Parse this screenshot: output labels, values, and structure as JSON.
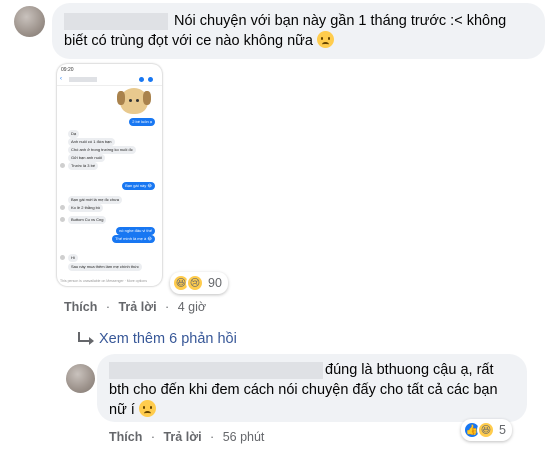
{
  "comment1": {
    "text_line1": "Nói chuyện với bạn này gần 1 tháng trước :< không",
    "text_line2": "biết có trùng đọt với ce nào không nữa",
    "emoji": "sad-face-icon",
    "reactions_count": "90",
    "like_label": "Thích",
    "reply_label": "Trả lời",
    "time": "4 giờ"
  },
  "screenshot": {
    "status_time": "09:20",
    "messages": [
      {
        "side": "out",
        "text": "2 bé luôn ạ"
      },
      {
        "side": "in",
        "text": "Dạ"
      },
      {
        "side": "in",
        "text": "Anh nuôi có 1 đứa bạn"
      },
      {
        "side": "in",
        "text": "Chó anh ở trong trường ko nuôi đc"
      },
      {
        "side": "in",
        "text": "Gửi bạn anh nuôi"
      },
      {
        "side": "in",
        "text": "Trước là 3 bé"
      },
      {
        "side": "out",
        "text": "Bạn gái này 😂"
      },
      {
        "side": "in",
        "text": "Bạn gái mới là mẹ đc chưa"
      },
      {
        "side": "in",
        "text": "Ko lề 2 thằng bồ"
      },
      {
        "side": "in",
        "text": "Buttom Cu vs Cng"
      },
      {
        "side": "out",
        "text": "nó nghe đâu vl thế"
      },
      {
        "side": "out",
        "text": "Thế mình là mẹ à 😂"
      },
      {
        "side": "in",
        "text": "Hi"
      },
      {
        "side": "in",
        "text": "Sau này mua thêm làm mẹ chính thức"
      }
    ],
    "footer": "This person is unavailable on Messenger · More options"
  },
  "more_replies": "Xem thêm 6 phản hồi",
  "comment2": {
    "text_line1": "đúng là bthuong cậu ạ, rất",
    "text_line2": "bth cho đến khi đem cách nói chuyện đấy cho tất cả các bạn",
    "text_line3": "nữ í",
    "emoji": "sad-face-icon",
    "reactions_count": "5",
    "like_label": "Thích",
    "reply_label": "Trả lời",
    "time": "56 phút"
  },
  "colors": {
    "bubble": "#f0f2f5",
    "link": "#385898",
    "meta": "#65676b",
    "messenger_blue": "#1877f2"
  }
}
